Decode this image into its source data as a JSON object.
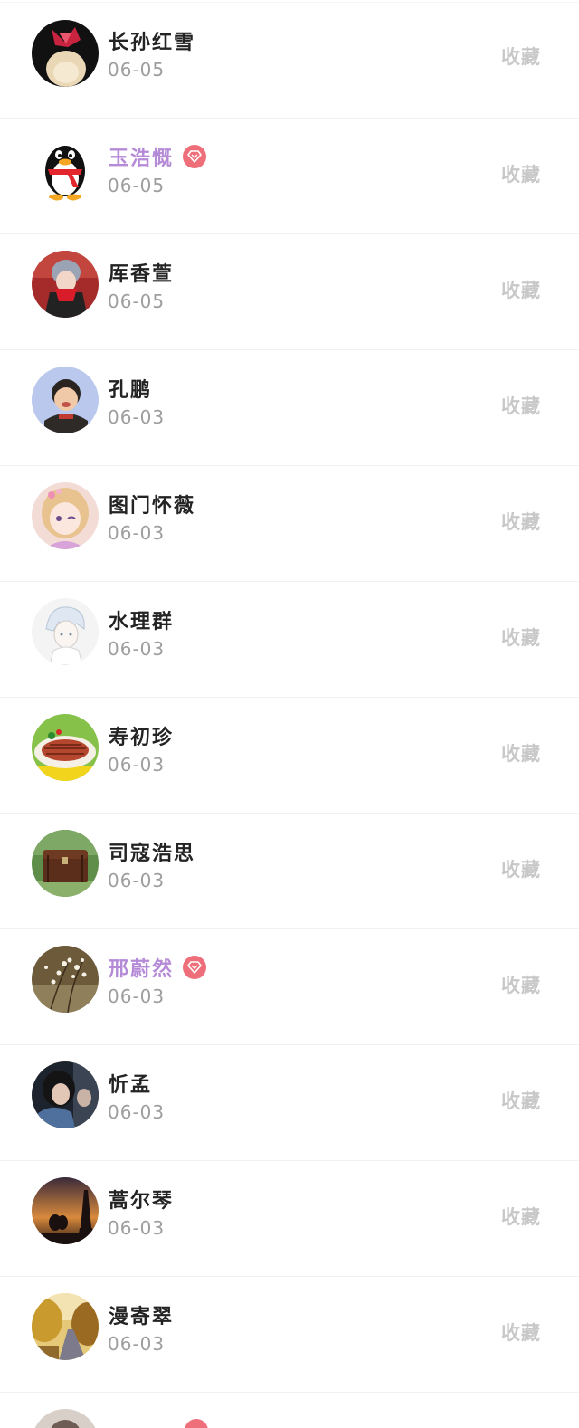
{
  "favorite_label": "收藏",
  "colors": {
    "vip_name": "#b58bd7",
    "vip_badge": "#ee6f79",
    "name": "#232323",
    "date": "#9e9e9e",
    "favorite_button": "#c8c8c8"
  },
  "users": [
    {
      "name": "长孙红雪",
      "date": "06-05",
      "vip": false,
      "avatar": "red-bow-avatar"
    },
    {
      "name": "玉浩慨",
      "date": "06-05",
      "vip": true,
      "avatar": "penguin-avatar"
    },
    {
      "name": "厍香萱",
      "date": "06-05",
      "vip": false,
      "avatar": "masked-person-avatar"
    },
    {
      "name": "孔鹏",
      "date": "06-03",
      "vip": false,
      "avatar": "child-avatar"
    },
    {
      "name": "图门怀薇",
      "date": "06-03",
      "vip": false,
      "avatar": "anime-girl-avatar"
    },
    {
      "name": "水理群",
      "date": "06-03",
      "vip": false,
      "avatar": "anime-boy-sketch-avatar"
    },
    {
      "name": "寿初珍",
      "date": "06-03",
      "vip": false,
      "avatar": "food-plate-avatar"
    },
    {
      "name": "司寇浩思",
      "date": "06-03",
      "vip": false,
      "avatar": "treasure-chest-avatar"
    },
    {
      "name": "邢蔚然",
      "date": "06-03",
      "vip": true,
      "avatar": "white-flowers-avatar"
    },
    {
      "name": "忻孟",
      "date": "06-03",
      "vip": false,
      "avatar": "girl-photo-avatar"
    },
    {
      "name": "蒿尔琴",
      "date": "06-03",
      "vip": false,
      "avatar": "eiffel-sunset-avatar"
    },
    {
      "name": "漫寄翠",
      "date": "06-03",
      "vip": false,
      "avatar": "autumn-road-avatar"
    }
  ]
}
